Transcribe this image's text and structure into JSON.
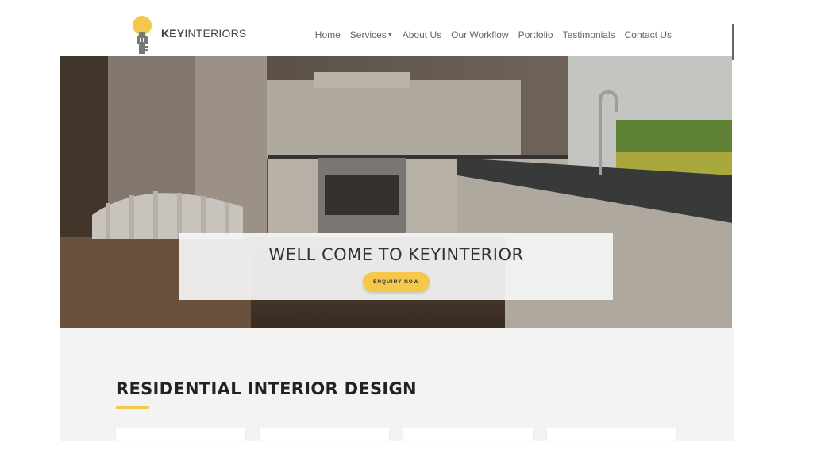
{
  "brand": {
    "name_bold": "KEY",
    "name_rest": "INTERIORS",
    "accent": "#f5c84c"
  },
  "nav": {
    "items": [
      {
        "label": "Home"
      },
      {
        "label": "Services",
        "has_dropdown": true
      },
      {
        "label": "About Us"
      },
      {
        "label": "Our Workflow"
      },
      {
        "label": "Portfolio"
      },
      {
        "label": "Testimonials"
      },
      {
        "label": "Contact Us"
      }
    ]
  },
  "hero": {
    "title": "WELL COME TO KEYINTERIOR",
    "button_label": "ENQUIRY NOW"
  },
  "section": {
    "title": "RESIDENTIAL INTERIOR DESIGN",
    "card_count": 4
  }
}
